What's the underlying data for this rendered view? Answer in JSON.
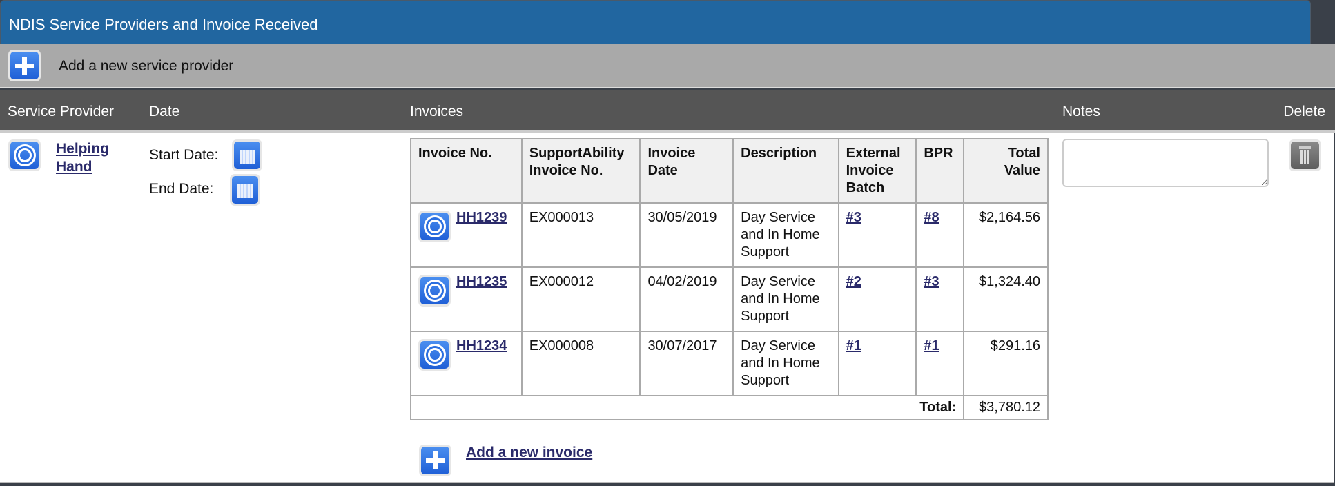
{
  "title": "NDIS Service Providers and Invoice Received",
  "add_provider_label": "Add a new service provider",
  "columns": {
    "provider": "Service Provider",
    "date": "Date",
    "invoices": "Invoices",
    "notes": "Notes",
    "delete": "Delete"
  },
  "provider": {
    "name_line1": "Helping",
    "name_line2": "Hand",
    "start_label": "Start Date:",
    "end_label": "End Date:",
    "notes": ""
  },
  "invoice_table": {
    "headers": [
      "Invoice No.",
      "SupportAbility Invoice No.",
      "Invoice Date",
      "Description",
      "External Invoice Batch",
      "BPR",
      "Total Value"
    ],
    "rows": [
      {
        "invoice_no": "HH1239",
        "sa_no": "EX000013",
        "date": "30/05/2019",
        "description": "Day Service and In Home Support",
        "batch": "#3",
        "bpr": "#8",
        "total": "$2,164.56"
      },
      {
        "invoice_no": "HH1235",
        "sa_no": "EX000012",
        "date": "04/02/2019",
        "description": "Day Service and In Home Support",
        "batch": "#2",
        "bpr": "#3",
        "total": "$1,324.40"
      },
      {
        "invoice_no": "HH1234",
        "sa_no": "EX000008",
        "date": "30/07/2017",
        "description": "Day Service and In Home Support",
        "batch": "#1",
        "bpr": "#1",
        "total": "$291.16"
      }
    ],
    "total_label": "Total:",
    "total_value": "$3,780.12"
  },
  "add_invoice_label": "Add a new invoice"
}
